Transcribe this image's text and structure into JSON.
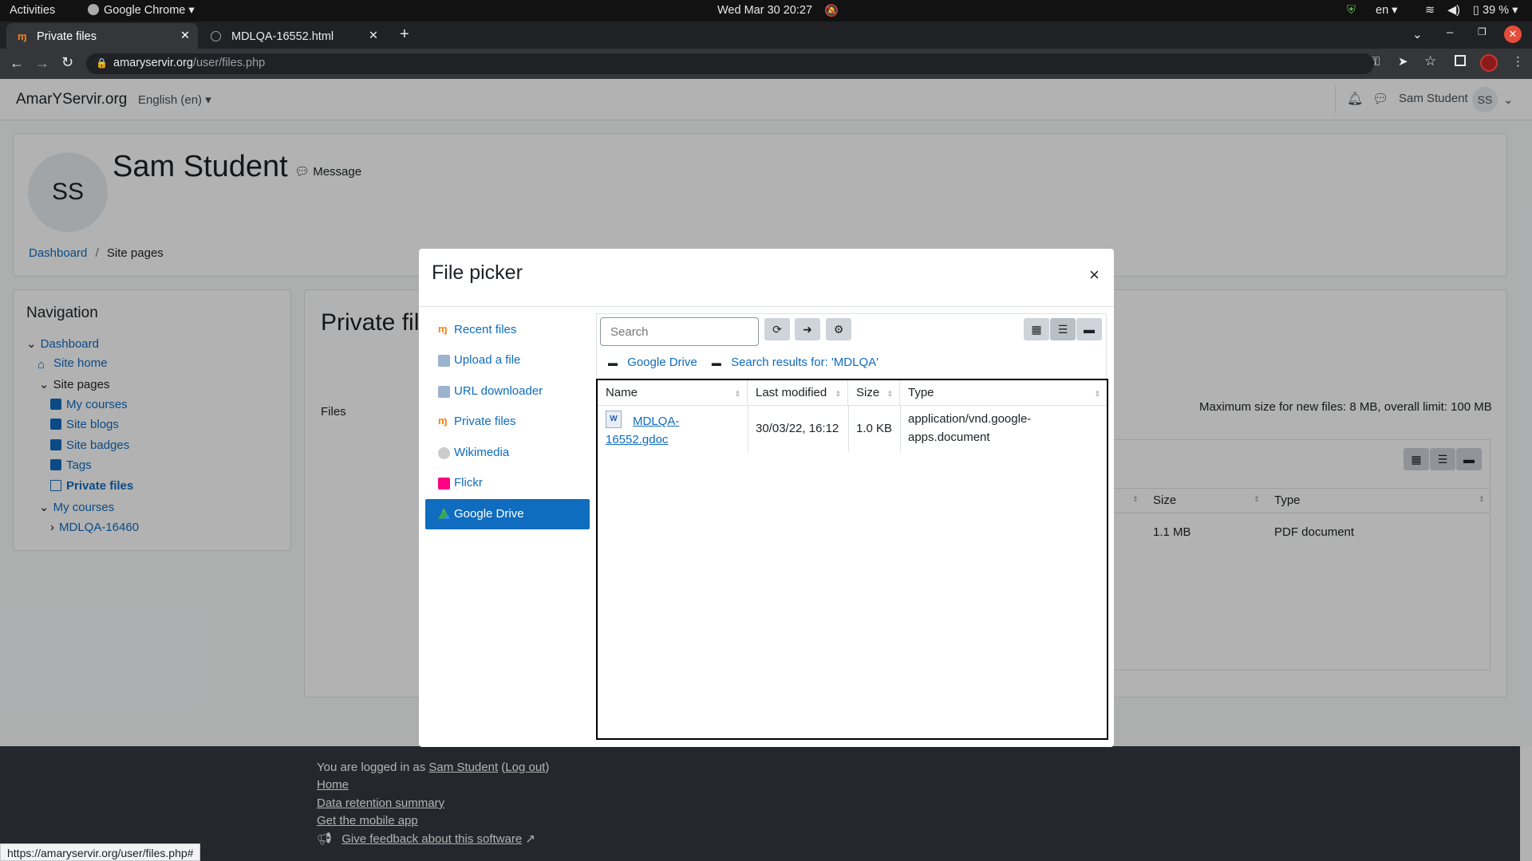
{
  "os": {
    "activities": "Activities",
    "app": "Google Chrome",
    "datetime": "Wed Mar 30  20:27",
    "lang": "en",
    "battery": "39 %"
  },
  "browser": {
    "tabs": [
      {
        "label": "Private files"
      },
      {
        "label": "MDLQA-16552.html"
      }
    ],
    "url_host": "amaryservir.org",
    "url_path": "/user/files.php",
    "status_url": "https://amaryservir.org/user/files.php#"
  },
  "site": {
    "brand": "AmarYServir.org",
    "language": "English (en)",
    "user_name": "Sam Student",
    "user_initials": "SS"
  },
  "profile": {
    "initials": "SS",
    "name": "Sam Student",
    "message_label": "Message",
    "breadcrumb": [
      "Dashboard",
      "Site pages"
    ]
  },
  "navigation": {
    "title": "Navigation",
    "items": [
      "Dashboard",
      "Site home",
      "Site pages",
      "My courses",
      "Site blogs",
      "Site badges",
      "Tags",
      "Private files",
      "My courses",
      "MDLQA-16460"
    ]
  },
  "content": {
    "title": "Private files",
    "files_label": "Files",
    "max_size": "Maximum size for new files: 8 MB, overall limit: 100 MB",
    "table_headers": [
      "Size",
      "Type"
    ],
    "row": {
      "size": "1.1 MB",
      "type": "PDF document"
    }
  },
  "modal": {
    "title": "File picker",
    "close": "×",
    "repos": [
      "Recent files",
      "Upload a file",
      "URL downloader",
      "Private files",
      "Wikimedia",
      "Flickr",
      "Google Drive"
    ],
    "search_placeholder": "Search",
    "path": [
      "Google Drive",
      "Search results for: 'MDLQA'"
    ],
    "columns": [
      "Name",
      "Last modified",
      "Size",
      "Type"
    ],
    "files": [
      {
        "name_line1": "MDLQA-",
        "name_line2": "16552.gdoc",
        "modified": "30/03/22, 16:12",
        "size": "1.0 KB",
        "type_line1": "application/vnd.google-",
        "type_line2": "apps.document"
      }
    ]
  },
  "footer": {
    "logged_prefix": "You are logged in as ",
    "user": "Sam Student",
    "logout": "Log out",
    "links": [
      "Home",
      "Data retention summary",
      "Get the mobile app"
    ],
    "feedback": "Give feedback about this software"
  }
}
